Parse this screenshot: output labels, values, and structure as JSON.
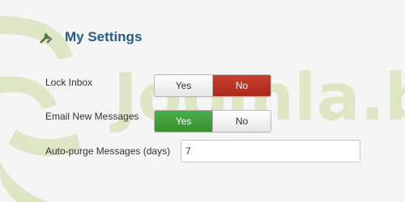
{
  "section": {
    "title": "My Settings",
    "icon": "wrench-icon"
  },
  "settings": {
    "lock_inbox": {
      "label": "Lock Inbox",
      "yes_label": "Yes",
      "no_label": "No",
      "selected": "No"
    },
    "email_new_messages": {
      "label": "Email New Messages",
      "yes_label": "Yes",
      "no_label": "No",
      "selected": "Yes"
    },
    "auto_purge": {
      "label": "Auto-purge Messages (days)",
      "value": "7"
    }
  },
  "watermark": {
    "text": "Joomla.b"
  },
  "colors": {
    "title": "#2a5c85",
    "active_no": "#b9321f",
    "active_yes": "#45a23f",
    "watermark": "#dfe8c8"
  }
}
